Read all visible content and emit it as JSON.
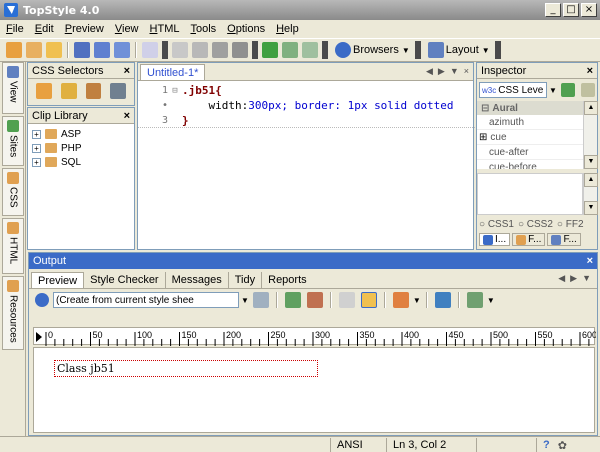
{
  "window": {
    "title": "TopStyle 4.0",
    "buttons": [
      "_",
      "□",
      "×"
    ]
  },
  "menu": [
    "File",
    "Edit",
    "Preview",
    "View",
    "HTML",
    "Tools",
    "Options",
    "Help"
  ],
  "toolbar": {
    "browsers_label": "Browsers",
    "layout_label": "Layout"
  },
  "vtabs": [
    "View",
    "Sites",
    "CSS",
    "HTML",
    "Resources"
  ],
  "css_selectors": {
    "title": "CSS Selectors"
  },
  "clip_library": {
    "title": "Clip Library",
    "items": [
      "ASP",
      "PHP",
      "SQL"
    ]
  },
  "editor": {
    "tab_label": "Untitled-1*",
    "lines": [
      {
        "num": "1",
        "fold": "⊟",
        "selector": ".jb51{",
        "prop": "",
        "value": ""
      },
      {
        "num": "•",
        "fold": "",
        "selector": "",
        "prop": "    width:",
        "value": "300px; border: 1px solid dotted"
      },
      {
        "num": "3",
        "fold": "",
        "selector": "}",
        "prop": "",
        "value": ""
      }
    ]
  },
  "inspector": {
    "title": "Inspector",
    "level_select": "CSS Leve",
    "group": "Aural",
    "properties": [
      "azimuth",
      "cue",
      "cue-after",
      "cue-before"
    ],
    "css_options": [
      "CSS1",
      "CSS2",
      "FF2"
    ],
    "bottom_tabs": [
      "I...",
      "F...",
      "F..."
    ]
  },
  "output": {
    "title": "Output",
    "tabs": [
      "Preview",
      "Style Checker",
      "Messages",
      "Tidy",
      "Reports"
    ],
    "select_value": "(Create from current style shee",
    "ruler_labels": [
      "0",
      "50",
      "100",
      "150",
      "200",
      "250",
      "300",
      "350",
      "400",
      "450",
      "500",
      "550",
      "600"
    ],
    "preview_text": "Class jb51"
  },
  "statusbar": {
    "encoding": "ANSI",
    "position": "Ln 3, Col 2"
  },
  "colors": {
    "output_header": "#3b6bc7",
    "editor_tab_text": "#3050d0",
    "selector": "#800000",
    "value": "#0000d0"
  }
}
